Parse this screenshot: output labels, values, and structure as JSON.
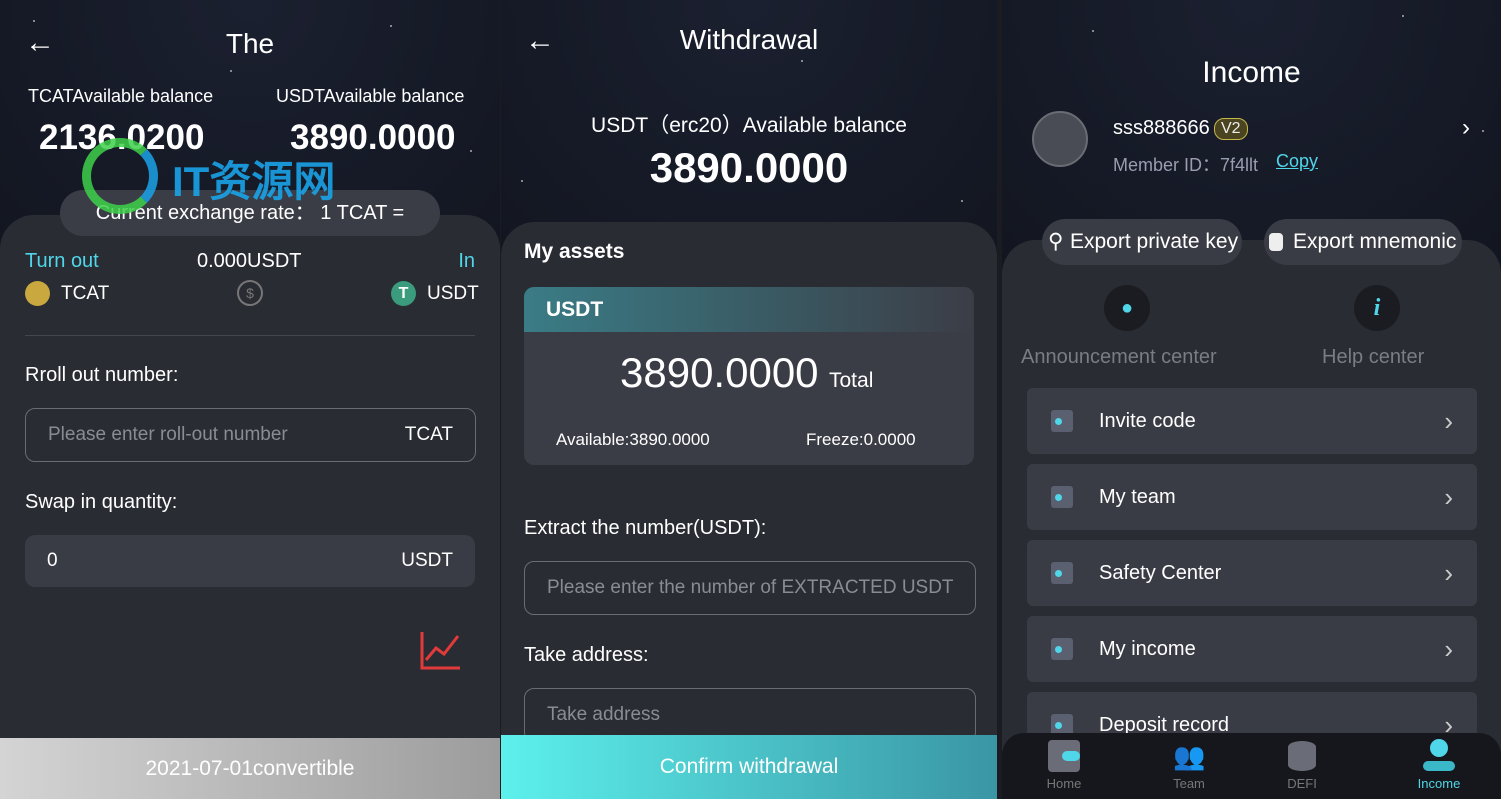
{
  "swap": {
    "title": "The",
    "tcat_label": "TCATAvailable balance",
    "usdt_label": "USDTAvailable balance",
    "tcat_balance": "2136.0200",
    "usdt_balance": "3890.0000",
    "rate": "Current exchange rate： 1 TCAT =",
    "turn_out": "Turn out",
    "amount": "0.000USDT",
    "in": "In",
    "from_coin": "TCAT",
    "to_coin": "USDT",
    "roll_label": "Rroll out number:",
    "roll_placeholder": "Please enter roll-out number",
    "roll_unit": "TCAT",
    "swap_label": "Swap in quantity:",
    "swap_value": "0",
    "swap_unit": "USDT",
    "bottom": "2021-07-01convertible",
    "watermark": "IT资源网"
  },
  "withdrawal": {
    "title": "Withdrawal",
    "balance_label": "USDT（erc20）Available balance",
    "balance": "3890.0000",
    "assets_title": "My assets",
    "asset_name": "USDT",
    "total": "3890.0000",
    "total_label": "Total",
    "available": "Available:3890.0000",
    "freeze": "Freeze:0.0000",
    "extract_label": "Extract the number(USDT):",
    "extract_placeholder": "Please enter the number of EXTRACTED USDT",
    "address_label": "Take address:",
    "address_placeholder": "Take address",
    "confirm": "Confirm withdrawal"
  },
  "income": {
    "title": "Income",
    "username": "sss888666",
    "level": "V2",
    "member_id": "Member ID：7f4llt",
    "copy": "Copy",
    "export_key": "Export private key",
    "export_mnemonic": "Export mnemonic",
    "announcement": "Announcement center",
    "help": "Help center",
    "menu": [
      {
        "label": "Invite code"
      },
      {
        "label": "My team"
      },
      {
        "label": "Safety Center"
      },
      {
        "label": "My income"
      },
      {
        "label": "Deposit record"
      }
    ],
    "nav": [
      {
        "label": "Home"
      },
      {
        "label": "Team"
      },
      {
        "label": "DEFI"
      },
      {
        "label": "Income",
        "active": true
      }
    ]
  },
  "colors": {
    "accent": "#4fd6e8",
    "card": "#2a2c33",
    "header": "#0f121a"
  }
}
